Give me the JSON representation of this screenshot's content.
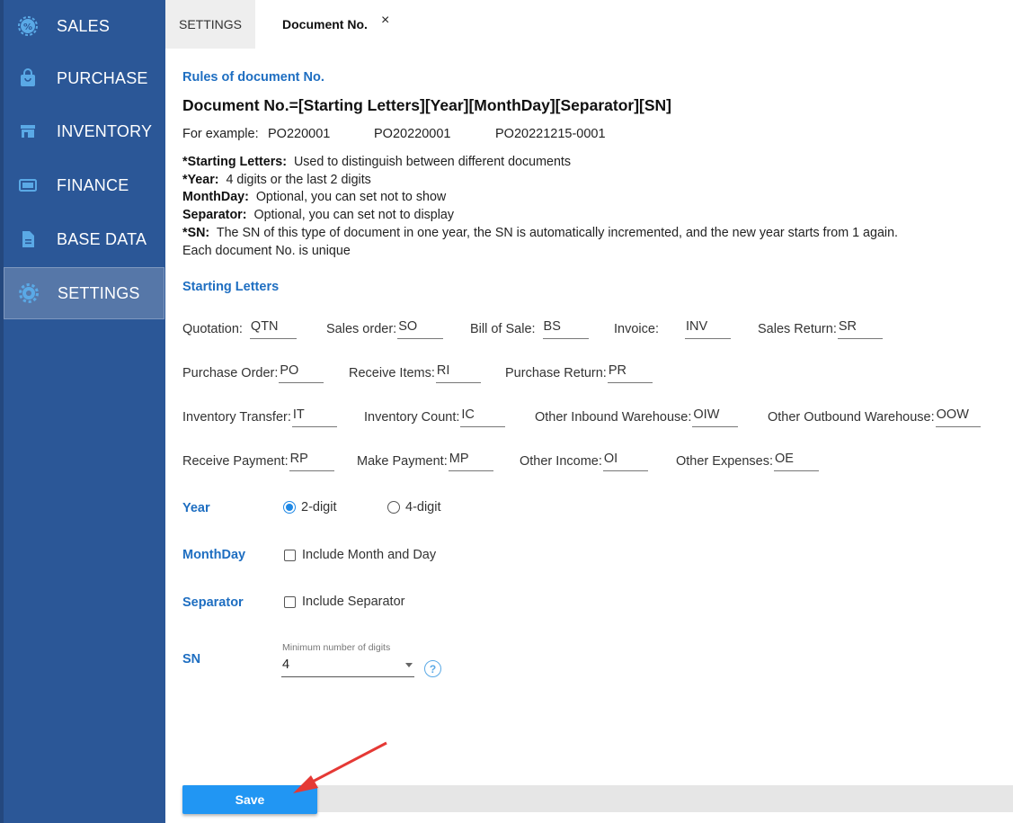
{
  "sidebar": {
    "items": [
      {
        "label": "SALES",
        "icon": "gear-badge-icon"
      },
      {
        "label": "PURCHASE",
        "icon": "shopping-bag-icon"
      },
      {
        "label": "INVENTORY",
        "icon": "store-icon"
      },
      {
        "label": "FINANCE",
        "icon": "money-icon"
      },
      {
        "label": "BASE DATA",
        "icon": "document-icon"
      },
      {
        "label": "SETTINGS",
        "icon": "gear-icon",
        "active": true
      }
    ]
  },
  "tabs": {
    "settings": "SETTINGS",
    "document_no": "Document No.",
    "close": "×"
  },
  "rules": {
    "title": "Rules of document No.",
    "formula": "Document No.=[Starting Letters][Year][MonthDay][Separator][SN]",
    "example_label": "For example:",
    "examples": [
      "PO220001",
      "PO20220001",
      "PO20221215-0001"
    ],
    "desc": {
      "starting_letters_term": "*Starting Letters:",
      "starting_letters_text": "Used to distinguish between different documents",
      "year_term": "*Year:",
      "year_text": "4 digits or the last 2 digits",
      "monthday_term": "MonthDay:",
      "monthday_text": "Optional, you can set not to show",
      "separator_term": "Separator:",
      "separator_text": "Optional, you can set not to display",
      "sn_term": "*SN:",
      "sn_text": "The SN of this type of document in one year, the SN is automatically incremented, and the new year starts from 1 again.",
      "unique_text": "Each document No. is unique"
    }
  },
  "starting_letters": {
    "title": "Starting Letters",
    "fields": {
      "quotation": {
        "label": "Quotation:",
        "value": "QTN"
      },
      "sales_order": {
        "label": "Sales order:",
        "value": "SO"
      },
      "bill_of_sale": {
        "label": "Bill of Sale:",
        "value": "BS"
      },
      "invoice": {
        "label": "Invoice:",
        "value": "INV"
      },
      "sales_return": {
        "label": "Sales Return:",
        "value": "SR"
      },
      "purchase_order": {
        "label": "Purchase Order:",
        "value": "PO"
      },
      "receive_items": {
        "label": "Receive Items:",
        "value": "RI"
      },
      "purchase_return": {
        "label": "Purchase Return:",
        "value": "PR"
      },
      "inventory_transfer": {
        "label": "Inventory Transfer:",
        "value": "IT"
      },
      "inventory_count": {
        "label": "Inventory Count:",
        "value": "IC"
      },
      "other_inbound": {
        "label": "Other Inbound Warehouse:",
        "value": "OIW"
      },
      "other_outbound": {
        "label": "Other Outbound Warehouse:",
        "value": "OOW"
      },
      "receive_payment": {
        "label": "Receive Payment:",
        "value": "RP"
      },
      "make_payment": {
        "label": "Make Payment:",
        "value": "MP"
      },
      "other_income": {
        "label": "Other Income:",
        "value": "OI"
      },
      "other_expenses": {
        "label": "Other Expenses:",
        "value": "OE"
      }
    }
  },
  "year": {
    "label": "Year",
    "option_2": "2-digit",
    "option_4": "4-digit",
    "selected": "2-digit"
  },
  "monthday": {
    "label": "MonthDay",
    "checkbox_label": "Include Month and Day",
    "checked": false
  },
  "separator": {
    "label": "Separator",
    "checkbox_label": "Include Separator",
    "checked": false
  },
  "sn": {
    "label": "SN",
    "helper": "Minimum number of digits",
    "value": "4",
    "help": "?"
  },
  "footer": {
    "save_label": "Save"
  },
  "colors": {
    "sidebar": "#2b5797",
    "accent": "#1e6ec1",
    "button": "#2196f3",
    "annotation_arrow": "#e53935"
  }
}
